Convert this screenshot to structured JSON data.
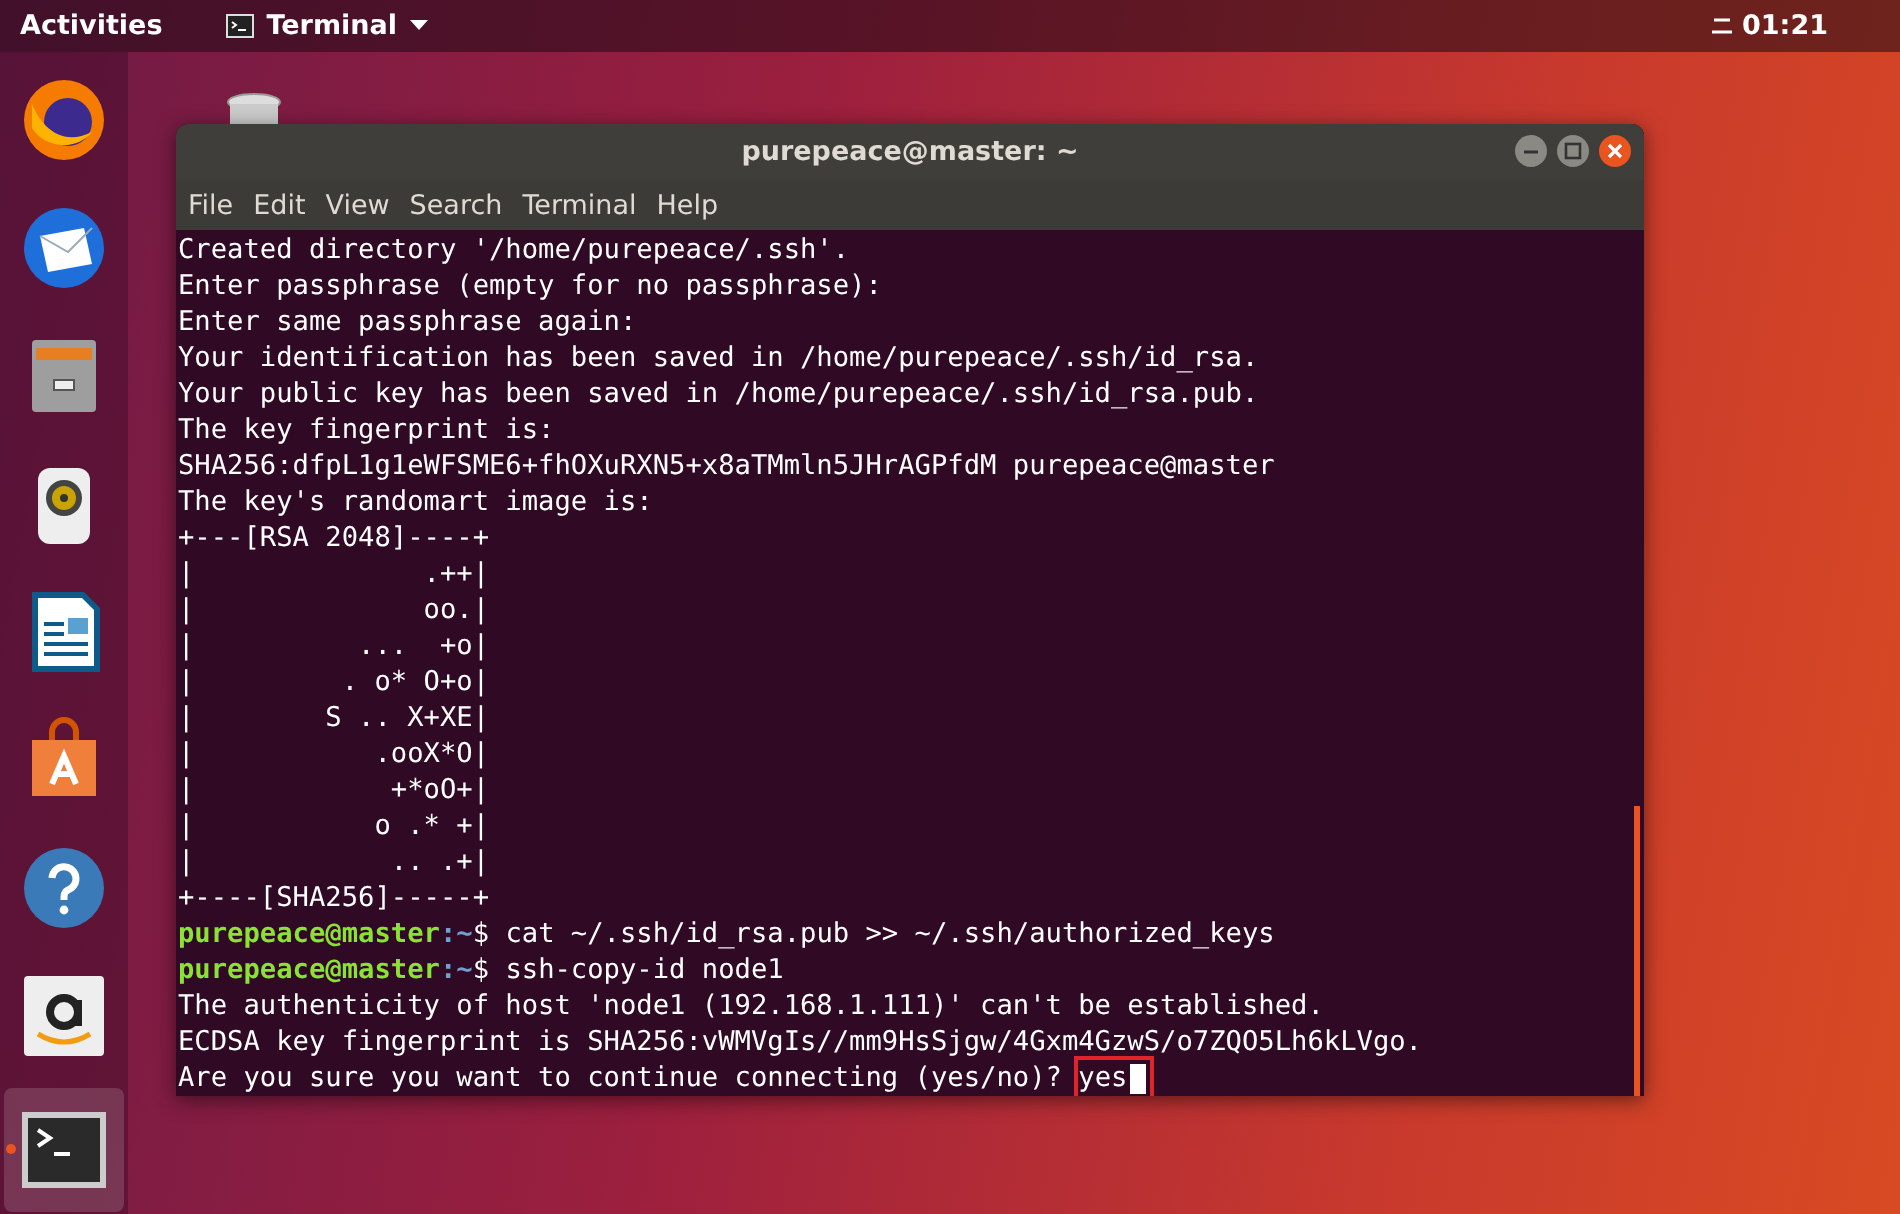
{
  "top_bar": {
    "activities": "Activities",
    "app_menu": "Terminal",
    "clock": "01:21"
  },
  "dock": {
    "items": [
      {
        "kind": "firefox",
        "running": false
      },
      {
        "kind": "mail",
        "running": false
      },
      {
        "kind": "files",
        "running": false
      },
      {
        "kind": "speaker",
        "running": false
      },
      {
        "kind": "writer",
        "running": false
      },
      {
        "kind": "store",
        "running": false
      },
      {
        "kind": "help",
        "running": false
      },
      {
        "kind": "amazon",
        "running": false
      },
      {
        "kind": "terminal",
        "running": true
      }
    ]
  },
  "window": {
    "title": "purepeace@master: ~",
    "menu": [
      "File",
      "Edit",
      "View",
      "Search",
      "Terminal",
      "Help"
    ],
    "lines": [
      {
        "kind": "output",
        "text": "Created directory '/home/purepeace/.ssh'."
      },
      {
        "kind": "output",
        "text": "Enter passphrase (empty for no passphrase):"
      },
      {
        "kind": "output",
        "text": "Enter same passphrase again:"
      },
      {
        "kind": "output",
        "text": "Your identification has been saved in /home/purepeace/.ssh/id_rsa."
      },
      {
        "kind": "output",
        "text": "Your public key has been saved in /home/purepeace/.ssh/id_rsa.pub."
      },
      {
        "kind": "output",
        "text": "The key fingerprint is:"
      },
      {
        "kind": "output",
        "text": "SHA256:dfpL1g1eWFSME6+fhOXuRXN5+x8aTMmln5JHrAGPfdM purepeace@master"
      },
      {
        "kind": "output",
        "text": "The key's randomart image is:"
      },
      {
        "kind": "output",
        "text": "+---[RSA 2048]----+"
      },
      {
        "kind": "output",
        "text": "|              .++|"
      },
      {
        "kind": "output",
        "text": "|              oo.|"
      },
      {
        "kind": "output",
        "text": "|          ...  +o|"
      },
      {
        "kind": "output",
        "text": "|         . o* O+o|"
      },
      {
        "kind": "output",
        "text": "|        S .. X+XE|"
      },
      {
        "kind": "output",
        "text": "|           .ooX*O|"
      },
      {
        "kind": "output",
        "text": "|            +*oO+|"
      },
      {
        "kind": "output",
        "text": "|           o .* +|"
      },
      {
        "kind": "output",
        "text": "|            .. .+|"
      },
      {
        "kind": "output",
        "text": "+----[SHA256]-----+"
      },
      {
        "kind": "prompt",
        "user": "purepeace@master",
        "path": ":~",
        "text": "$ cat ~/.ssh/id_rsa.pub >> ~/.ssh/authorized_keys"
      },
      {
        "kind": "prompt",
        "user": "purepeace@master",
        "path": ":~",
        "text": "$ ssh-copy-id node1"
      },
      {
        "kind": "output",
        "text": "The authenticity of host 'node1 (192.168.1.111)' can't be established."
      },
      {
        "kind": "output",
        "text": "ECDSA key fingerprint is SHA256:vWMVgIs//mm9HsSjgw/4Gxm4GzwS/o7ZQO5Lh6kLVgo."
      },
      {
        "kind": "question",
        "text": "Are you sure you want to continue connecting (yes/no)? ",
        "answer": "yes",
        "highlighted": true
      }
    ]
  }
}
